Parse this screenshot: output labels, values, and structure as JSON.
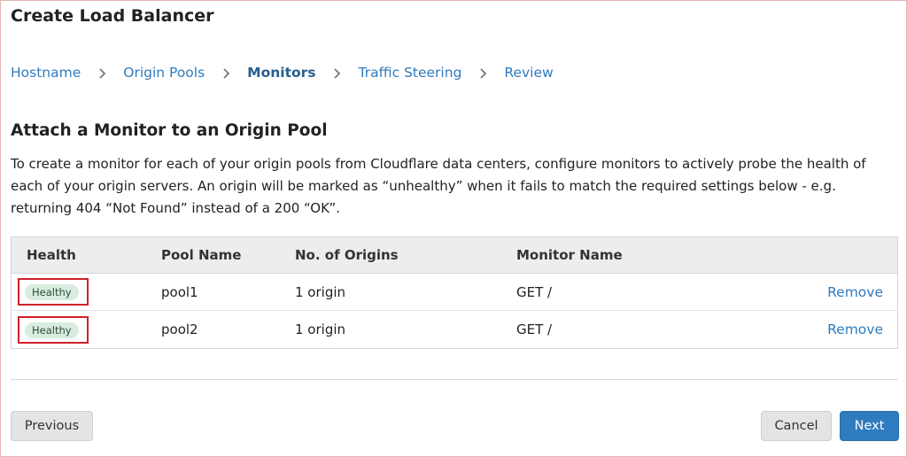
{
  "header": {
    "title": "Create Load Balancer"
  },
  "breadcrumb": {
    "steps": [
      {
        "label": "Hostname"
      },
      {
        "label": "Origin Pools"
      },
      {
        "label": "Monitors"
      },
      {
        "label": "Traffic Steering"
      },
      {
        "label": "Review"
      }
    ],
    "active": "Monitors",
    "separator_icon": "chevron-right-icon"
  },
  "main": {
    "section_title": "Attach a Monitor to an Origin Pool",
    "description": "To create a monitor for each of your origin pools from Cloudflare data centers, configure monitors to actively probe the health of each of your origin servers. An origin will be marked as “unhealthy” when it fails to match the required settings below - e.g. returning 404 “Not Found” instead of a 200 “OK”."
  },
  "table": {
    "columns": [
      "Health",
      "Pool Name",
      "No. of Origins",
      "Monitor Name"
    ],
    "rows": [
      {
        "health": "Healthy",
        "pool_name": "pool1",
        "origins": "1 origin",
        "monitor": "GET /",
        "action": "Remove"
      },
      {
        "health": "Healthy",
        "pool_name": "pool2",
        "origins": "1 origin",
        "monitor": "GET /",
        "action": "Remove"
      }
    ]
  },
  "footer": {
    "previous_label": "Previous",
    "cancel_label": "Cancel",
    "next_label": "Next"
  },
  "colors": {
    "accent": "#2f7bbf",
    "healthy_badge_bg": "#d8ede0",
    "highlight_border": "#d0202a"
  }
}
